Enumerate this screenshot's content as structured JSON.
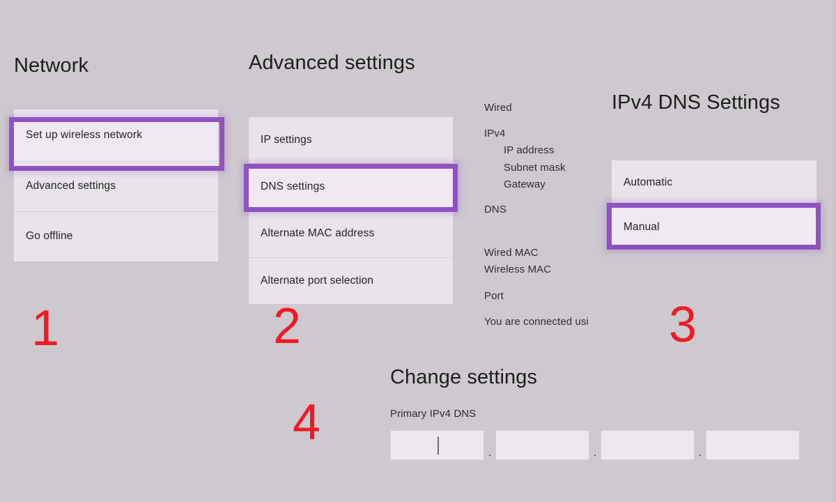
{
  "page": {
    "background_color": "#cdc9ce",
    "panel_color": "#e9e4ea",
    "highlight_color": "#8f52c0",
    "step_number_color": "#ed1c24"
  },
  "network": {
    "heading": "Network",
    "items": [
      {
        "label": "Set up wireless network",
        "selected": true
      },
      {
        "label": "Advanced settings",
        "selected": false
      },
      {
        "label": "Go offline",
        "selected": false
      }
    ]
  },
  "advanced": {
    "heading": "Advanced settings",
    "items": [
      {
        "label": "IP settings",
        "selected": false
      },
      {
        "label": "DNS settings",
        "selected": true
      },
      {
        "label": "Alternate MAC address",
        "selected": false
      },
      {
        "label": "Alternate port selection",
        "selected": false
      }
    ]
  },
  "info": {
    "lines": [
      {
        "text": "Wired",
        "indent": false
      },
      {
        "text": "IPv4",
        "indent": false
      },
      {
        "text": "IP address",
        "indent": true
      },
      {
        "text": "Subnet mask",
        "indent": true
      },
      {
        "text": "Gateway",
        "indent": true
      },
      {
        "text": "DNS",
        "indent": false
      },
      {
        "text": "Wired MAC",
        "indent": false
      },
      {
        "text": "Wireless MAC",
        "indent": false
      },
      {
        "text": "Port",
        "indent": false
      },
      {
        "text": "You are connected usi",
        "indent": false
      }
    ]
  },
  "dns_settings": {
    "heading": "IPv4 DNS Settings",
    "items": [
      {
        "label": "Automatic",
        "selected": false
      },
      {
        "label": "Manual",
        "selected": true
      }
    ]
  },
  "change_settings": {
    "heading": "Change settings",
    "field_label": "Primary IPv4 DNS",
    "separator": ".",
    "octets": [
      {
        "value": "",
        "focused": true
      },
      {
        "value": "",
        "focused": false
      },
      {
        "value": "",
        "focused": false
      },
      {
        "value": "",
        "focused": false
      }
    ]
  },
  "steps": [
    {
      "number": "1"
    },
    {
      "number": "2"
    },
    {
      "number": "3"
    },
    {
      "number": "4"
    }
  ]
}
